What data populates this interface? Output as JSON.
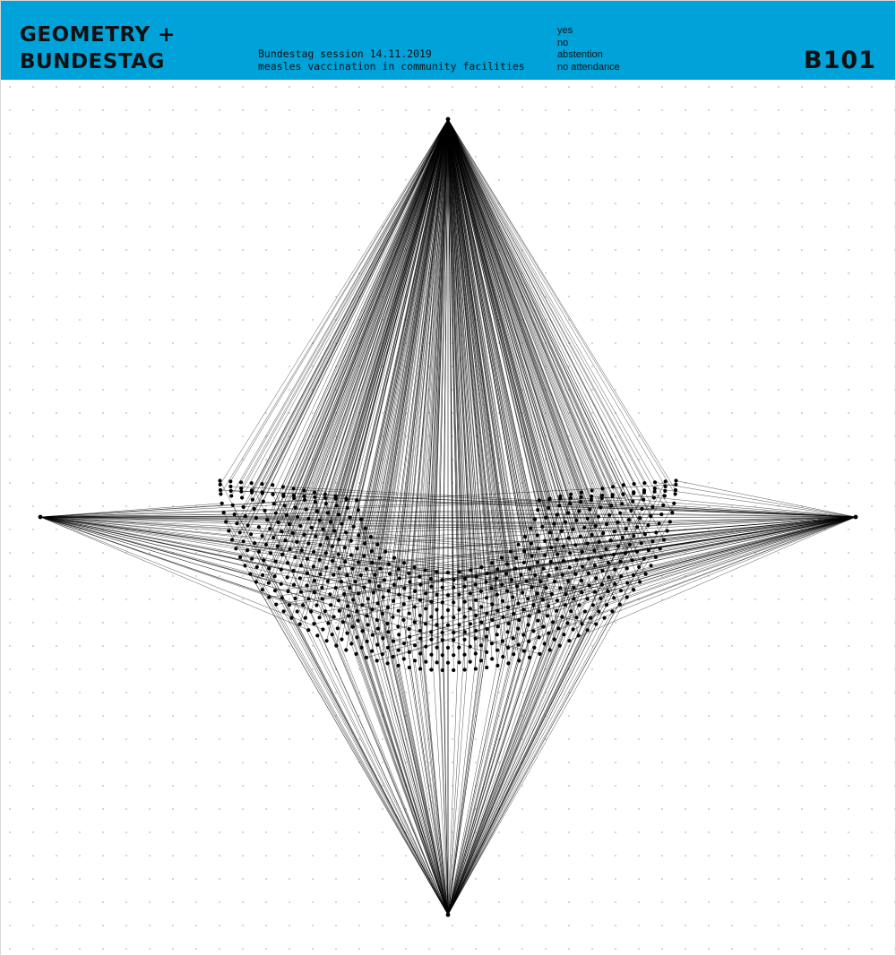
{
  "header": {
    "title_line1": "GEOMETRY +",
    "title_line2": "BUNDESTAG",
    "session_line1": "Bundestag session 14.11.2019",
    "session_line2": "measles vaccination in community facilities",
    "code": "B101",
    "background_color": "#00a3d9"
  },
  "legend": {
    "items": [
      "yes",
      "no",
      "abstention",
      "no attendance"
    ]
  },
  "diagram": {
    "anchors": {
      "yes": "top",
      "no": "right",
      "abstention": "left",
      "no_attendance": "bottom"
    },
    "line_color": "#000000",
    "dot_color": "#000000",
    "grid_dot_color": "#c8c8c8"
  }
}
